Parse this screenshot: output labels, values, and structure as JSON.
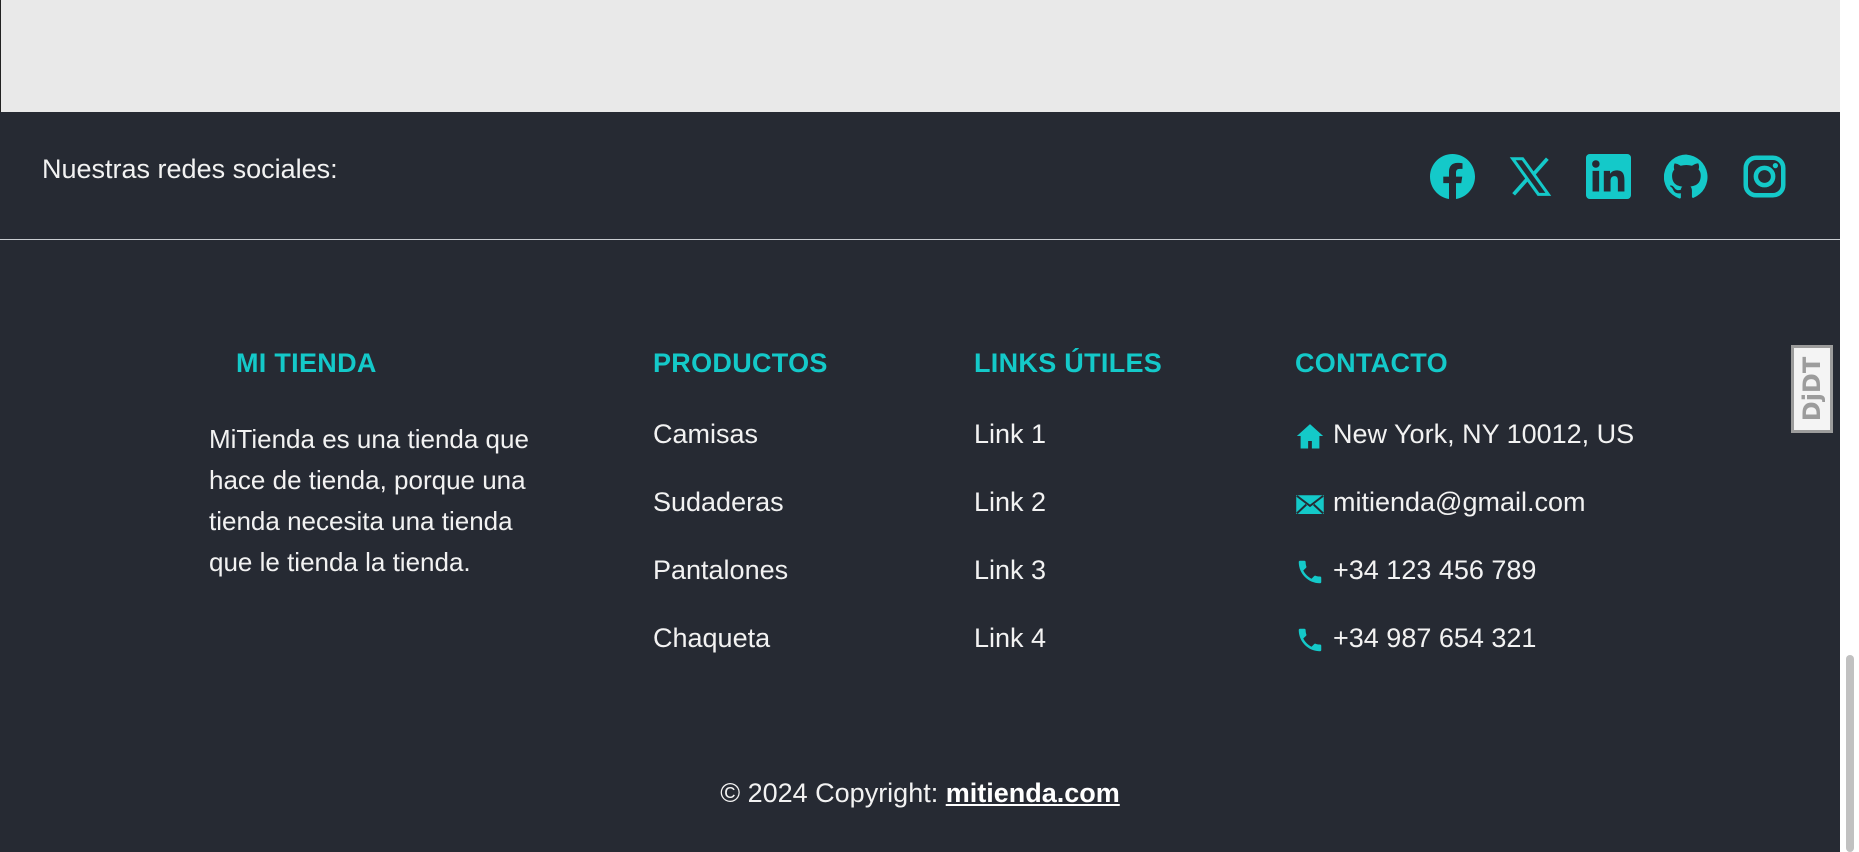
{
  "social": {
    "label": "Nuestras redes sociales:",
    "icons": [
      "facebook-icon",
      "x-icon",
      "linkedin-icon",
      "github-icon",
      "instagram-icon"
    ]
  },
  "about": {
    "title": "MI TIENDA",
    "text": "MiTienda es una tienda que hace de tienda, porque una tienda necesita una tienda que le tienda la tienda."
  },
  "products": {
    "title": "PRODUCTOS",
    "items": [
      "Camisas",
      "Sudaderas",
      "Pantalones",
      "Chaqueta"
    ]
  },
  "links": {
    "title": "LINKS ÚTILES",
    "items": [
      "Link 1",
      "Link 2",
      "Link 3",
      "Link 4"
    ]
  },
  "contact": {
    "title": "CONTACTO",
    "address": "New York, NY 10012, US",
    "email": "mitienda@gmail.com",
    "phone1": "+34 123 456 789",
    "phone2": "+34 987 654 321"
  },
  "copyright": {
    "text": "© 2024 Copyright: ",
    "link": "mitienda.com"
  },
  "djdt": {
    "label": "DjDT"
  },
  "colors": {
    "accent": "#14c9c9",
    "footer_bg": "#262a33",
    "top_bg": "#e9e9e9"
  }
}
